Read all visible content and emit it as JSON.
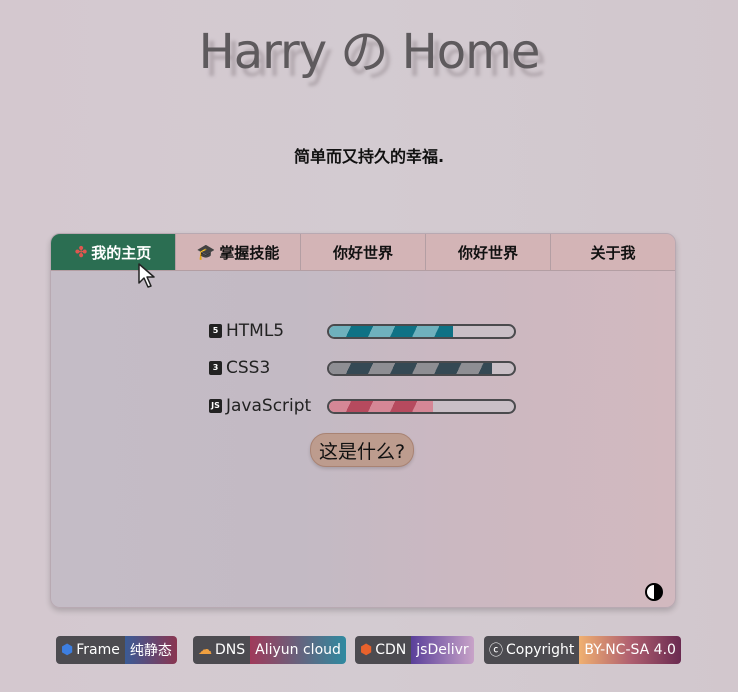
{
  "header": {
    "title": "Harry の Home",
    "subtitle": "简单而又持久的幸福."
  },
  "tabs": [
    {
      "label": "我的主页",
      "icon": "pinwheel-icon",
      "active": true
    },
    {
      "label": "掌握技能",
      "icon": "graduation-cap-icon",
      "active": false
    },
    {
      "label": "你好世界",
      "active": false
    },
    {
      "label": "你好世界",
      "active": false
    },
    {
      "label": "关于我",
      "active": false
    }
  ],
  "skills": [
    {
      "label": "HTML5",
      "icon": "html5-icon",
      "level": 0.67,
      "colors": [
        "#6fb1bd",
        "#0f7285"
      ]
    },
    {
      "label": "CSS3",
      "icon": "css3-icon",
      "level": 0.88,
      "colors": [
        "#8e8e93",
        "#354954"
      ]
    },
    {
      "label": "JavaScript",
      "icon": "javascript-icon",
      "level": 0.56,
      "colors": [
        "#d58796",
        "#b64a5e"
      ]
    }
  ],
  "what_button": "这是什么?",
  "footer": [
    {
      "left": "Frame",
      "right": "纯静态",
      "icon": "hexagon-icon"
    },
    {
      "left": "DNS",
      "right": "Aliyun cloud",
      "icon": "cloud-icon"
    },
    {
      "left": "CDN",
      "right": "jsDelivr",
      "icon": "jsdelivr-icon"
    },
    {
      "left": "Copyright",
      "right": "BY-NC-SA 4.0",
      "icon": "creative-commons-icon"
    }
  ],
  "colors": {
    "active_tab": "#2b6e52",
    "tab_bg": "#d3b4b6",
    "button_bg": "#bd9c8e"
  }
}
